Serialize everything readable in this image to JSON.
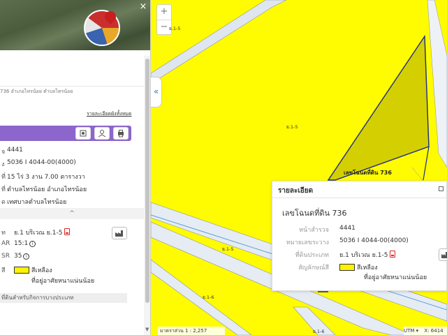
{
  "map": {
    "zoom_in": "+",
    "zoom_out": "−",
    "zone_labels": {
      "top_center": "ย.1-5",
      "mid": "ย.1-5",
      "left_low": "ย.1-5",
      "bottom_a": "ย.1-6",
      "bottom_b": "ย.1-6"
    },
    "parcel_label": "เลขโฉนดที่ดิน 736",
    "close_symbol": "×",
    "colors": {
      "zone_yellow": "#fffb00",
      "parcel_fill": "#d4cf00",
      "parcel_border": "#1a2a8c",
      "road": "#dfe6f0",
      "accent": "#8c66cc"
    }
  },
  "panel": {
    "address": "736 อำเภอไทรน้อย ตำบลไทรน้อย",
    "detail_link": "รายละเอียดผังทั้งหมด",
    "collapse_symbol": "«",
    "rows": {
      "survey_no": "4441",
      "map_sheet": "5036 I 4044-00(4000)",
      "area": "15 ไร่ 3 งาน 7.00 ตารางวา",
      "location": "ตำบลไทรน้อย อำเภอไทรน้อย",
      "municipality": "เทศบาลตำบลไทรน้อย"
    },
    "row_keys": {
      "survey_no": "จ",
      "map_sheet": "ง",
      "area": "ที่",
      "location": "ที่",
      "municipality": "ด"
    },
    "accordion_symbol": "^",
    "zoning": {
      "type_key": "ท",
      "type_value": "ย.1 บริเวณ ย.1-5",
      "far_key": "AR",
      "far_value": "15:1",
      "osr_key": "SR",
      "osr_value": "35",
      "color_key": "สี",
      "color_name": "สีเหลือง",
      "color_desc": "ที่อยู่อาศัยหนาแน่นน้อย"
    },
    "section_title": "ที่ดินสำหรับกิจการบางประเภท"
  },
  "popup": {
    "title": "รายละเอียด",
    "heading": "เลขโฉนดที่ดิน 736",
    "rows": [
      {
        "key": "หน้าสำรวจ",
        "value": "4441"
      },
      {
        "key": "หมายเลขระวาง",
        "value": "5036 I 4044-00(4000)"
      },
      {
        "key": "ที่ดินประเภท",
        "value": "ย.1 บริเวณ ย.1-5"
      },
      {
        "key": "สัญลักษณ์สี",
        "value": "สีเหลือง"
      }
    ],
    "color_desc": "ที่อยู่อาศัยหนาแน่นน้อย"
  },
  "footer": {
    "scale": "มาตราส่วน 1 : 2,257",
    "utm": "UTM ▾",
    "coord": "X: 6414"
  }
}
